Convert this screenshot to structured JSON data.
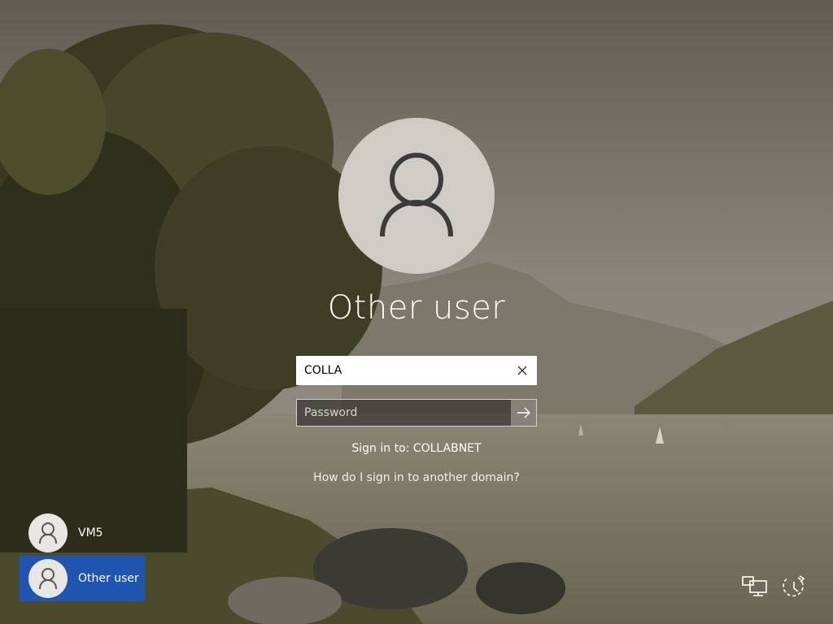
{
  "login": {
    "title": "Other user",
    "username_value": "COLLA",
    "password_placeholder": "Password",
    "sign_in_to": "Sign in to: COLLABNET",
    "help_link": "How do I sign in to another domain?"
  },
  "user_list": [
    {
      "label": "VM5"
    },
    {
      "label": "Other user"
    }
  ],
  "icons": {
    "avatar": "person-icon",
    "clear": "close-icon",
    "submit": "arrow-right-icon",
    "network": "network-icon",
    "ease_of_access": "ease-of-access-icon",
    "power": "power-icon"
  },
  "colors": {
    "selected_user": "#1f54b0",
    "avatar_bg": "#cfccc6",
    "text": "#ffffff"
  }
}
